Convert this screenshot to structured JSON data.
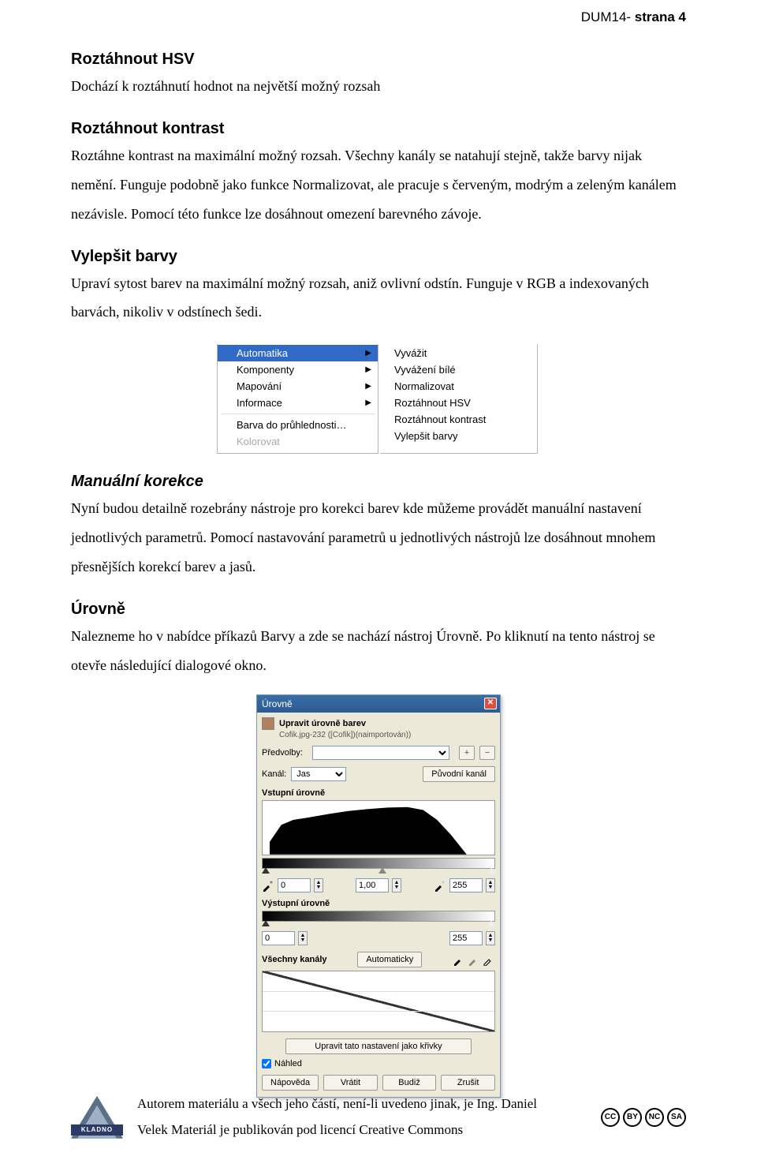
{
  "header": {
    "prefix": "DUM14- ",
    "bold": "strana 4"
  },
  "sections": {
    "hsv": {
      "title": "Roztáhnout HSV",
      "body": "Dochází k roztáhnutí hodnot na největší možný rozsah"
    },
    "kontrast": {
      "title": "Roztáhnout kontrast",
      "body": "Roztáhne kontrast na maximální možný rozsah. Všechny kanály se natahují stejně, takže barvy nijak nemění. Funguje podobně jako funkce Normalizovat, ale pracuje s červeným, modrým a zeleným kanálem nezávisle. Pomocí této funkce lze dosáhnout omezení barevného závoje."
    },
    "vylepsit": {
      "title": "Vylepšit barvy",
      "body": "Upraví sytost barev na maximální možný rozsah, aniž ovlivní odstín. Funguje v RGB a indexovaných barvách, nikoliv v odstínech šedi."
    },
    "manual": {
      "title": "Manuální korekce",
      "body": "Nyní budou detailně rozebrány nástroje pro korekci barev kde můžeme provádět manuální nastavení jednotlivých parametrů. Pomocí nastavování parametrů u jednotlivých nástrojů lze dosáhnout mnohem přesnějších korekcí barev a jasů."
    },
    "urovne": {
      "title": "Úrovně",
      "body": "Nalezneme ho v nabídce příkazů Barvy a zde se nachází nástroj Úrovně. Po kliknutí na tento nástroj se otevře následující dialogové okno."
    }
  },
  "menu": {
    "left": [
      {
        "label": "Automatika",
        "selected": true,
        "arrow": true
      },
      {
        "label": "Komponenty",
        "arrow": true,
        "accel": "e"
      },
      {
        "label": "Mapování",
        "arrow": true,
        "accel": "M"
      },
      {
        "label": "Informace",
        "arrow": true,
        "accel": "I"
      },
      {
        "sep": true
      },
      {
        "label": "Barva do průhlednosti…"
      },
      {
        "label": "Kolorovat",
        "faded": true
      }
    ],
    "right": [
      {
        "label": "Vyvážit",
        "accel": "V"
      },
      {
        "label": "Vyvážení bílé"
      },
      {
        "label": "Normalizovat",
        "accel": "N"
      },
      {
        "label": "Roztáhnout HSV",
        "accel": "H"
      },
      {
        "label": "Roztáhnout kontrast",
        "accel": "R"
      },
      {
        "label": "Vylepšit barvy",
        "accel": "V"
      }
    ]
  },
  "dialog": {
    "title": "Úrovně",
    "subtitle": "Upravit úrovně barev",
    "file": "Cofik.jpg-232 ([Cofik])(naimportován))",
    "presets_label": "Předvolby:",
    "channel_label": "Kanál:",
    "channel_value": "Jas",
    "reset_channel": "Původní kanál",
    "input_levels": "Vstupní úrovně",
    "output_levels": "Výstupní úrovně",
    "all_channels": "Všechny kanály",
    "auto": "Automaticky",
    "curves_btn": "Upravit tato nastavení jako křivky",
    "preview": "Náhled",
    "in_low": "0",
    "in_gamma": "1,00",
    "in_high": "255",
    "out_low": "0",
    "out_high": "255",
    "buttons": {
      "help": "Nápověda",
      "reset": "Vrátit",
      "ok": "Budiž",
      "cancel": "Zrušit"
    }
  },
  "footer": {
    "line1": "Autorem materiálu a všech jeho částí, není-li uvedeno jinak, je Ing. Daniel",
    "line2": "Velek Materiál je publikován pod licencí Creative Commons",
    "logo_band": "KLADNO"
  },
  "cc": [
    "CC",
    "BY",
    "NC",
    "SA"
  ]
}
